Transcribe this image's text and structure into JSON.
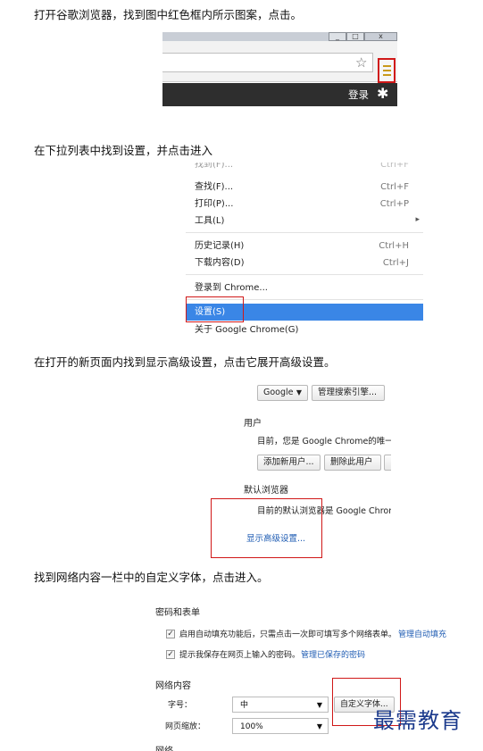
{
  "steps": [
    "打开谷歌浏览器，找到图中红色框内所示图案，点击。",
    "在下拉列表中找到设置，并点击进入",
    "在打开的新页面内找到显示高级设置，点击它展开高级设置。",
    "找到网络内容一栏中的自定义字体，点击进入。"
  ],
  "shot1": {
    "star_icon": "star-icon",
    "menu_icon": "hamburger-menu-icon",
    "login_label": "登录",
    "gear_icon": "gear-icon"
  },
  "shot2": {
    "items": [
      {
        "label": "找到(F)...",
        "shortcut": "Ctrl+F"
      },
      {
        "label": "查找(F)...",
        "shortcut": "Ctrl+F"
      },
      {
        "label": "打印(P)...",
        "shortcut": "Ctrl+P"
      },
      {
        "label": "工具(L)",
        "shortcut": ""
      },
      {
        "label": "历史记录(H)",
        "shortcut": "Ctrl+H"
      },
      {
        "label": "下载内容(D)",
        "shortcut": "Ctrl+J"
      },
      {
        "label": "登录到 Chrome...",
        "shortcut": ""
      },
      {
        "label": "设置(S)",
        "shortcut": ""
      },
      {
        "label": "关于 Google Chrome(G)",
        "shortcut": ""
      }
    ],
    "submenu_arrow": "▸",
    "highlight_color": "#3a86e6"
  },
  "shot3": {
    "search_engine": "Google",
    "manage_search": "管理搜索引擎...",
    "users_heading": "用户",
    "users_text": "目前，您是 Google Chrome的唯一用",
    "add_user": "添加新用户...",
    "remove_user": "删除此用户",
    "default_browser_heading": "默认浏览器",
    "default_browser_text": "目前的默认浏览器是 Google Chrome",
    "show_advanced": "显示高级设置..."
  },
  "shot4": {
    "passwords_heading": "密码和表单",
    "autofill_text": "启用自动填充功能后，只需点击一次即可填写多个网络表单。",
    "autofill_link": "管理自动填充",
    "save_pw_text": "提示我保存在网页上输入的密码。",
    "save_pw_link": "管理已保存的密码",
    "web_content_heading": "网络内容",
    "font_size_label": "字号：",
    "font_size_value": "中",
    "customize_fonts": "自定义字体...",
    "zoom_label": "网页缩放：",
    "zoom_value": "100%",
    "cut_heading": "网络"
  },
  "watermark": "最需教育",
  "accent_red": "#d01818"
}
